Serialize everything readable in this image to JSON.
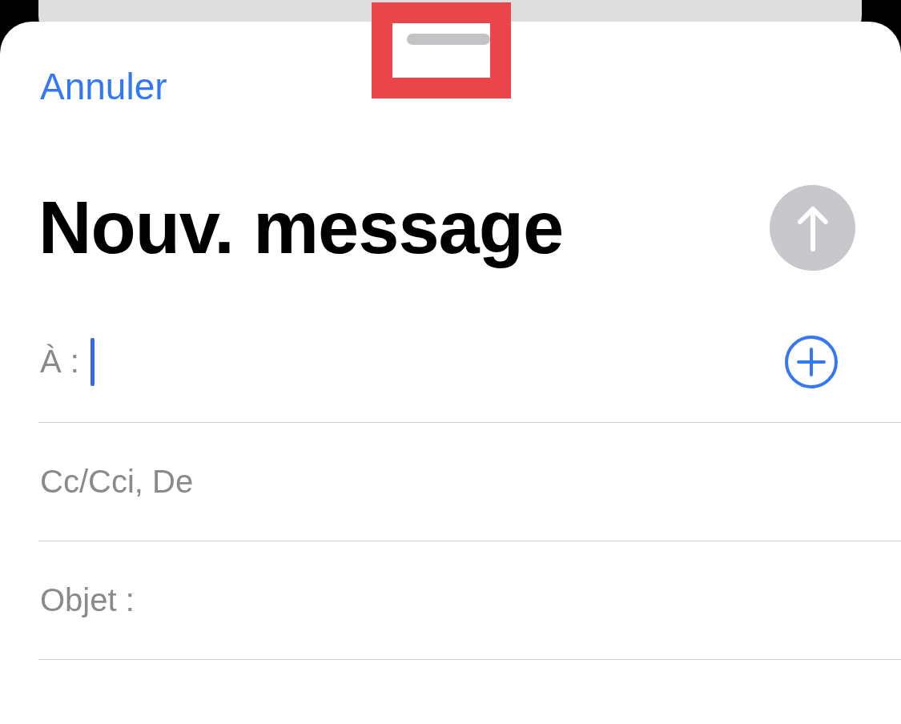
{
  "cancel_button": {
    "label": "Annuler"
  },
  "title": "Nouv. message",
  "send_button": {
    "disabled": true
  },
  "fields": [
    {
      "label": "À :",
      "focused": true,
      "add_button": true
    },
    {
      "label": "Cc/Cci, De",
      "focused": false,
      "add_button": false
    },
    {
      "label": "Objet :",
      "focused": false,
      "add_button": false
    }
  ]
}
